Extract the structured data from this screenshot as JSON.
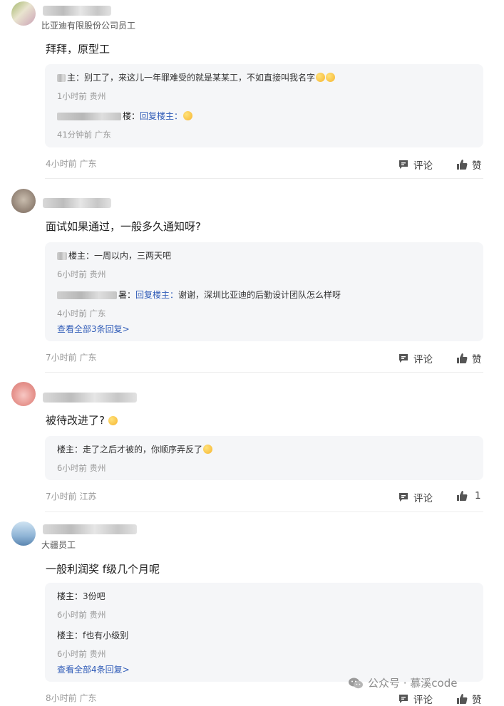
{
  "comments": [
    {
      "org": "比亚迪有限股份公司员工",
      "text": "拜拜，原型工",
      "replies": [
        {
          "author": "主：",
          "text": "别工了，来这儿一年罪难受的就是某某工，不如直接叫我名字",
          "meta": "1小时前 贵州"
        },
        {
          "author": "楼：",
          "reply_to": "回复楼主：",
          "text": "",
          "meta": "41分钟前 广东"
        }
      ],
      "more": "",
      "meta": "4小时前 广东",
      "comment_label": "评论",
      "like_label": "赞"
    },
    {
      "org": "",
      "text": "面试如果通过，一般多久通知呀?",
      "replies": [
        {
          "author": "楼主：",
          "text": "一周以内，三两天吧",
          "meta": "6小时前 贵州"
        },
        {
          "author": "暑：",
          "reply_to": "回复楼主：",
          "text": "谢谢，深圳比亚迪的后勤设计团队怎么样呀",
          "meta": "4小时前 广东"
        }
      ],
      "more": "查看全部3条回复>",
      "meta": "7小时前 广东",
      "comment_label": "评论",
      "like_label": "赞"
    },
    {
      "org": "",
      "text": "被待改进了?",
      "replies": [
        {
          "author": "楼主：",
          "text": "走了之后才被的，你顺序弄反了",
          "meta": "6小时前 贵州"
        }
      ],
      "more": "",
      "meta": "7小时前 江苏",
      "comment_label": "评论",
      "like_label": "1"
    },
    {
      "org": "大疆员工",
      "text": "一般利润奖 f级几个月呢",
      "replies": [
        {
          "author": "楼主：",
          "text": "3份吧",
          "meta": "6小时前 贵州"
        },
        {
          "author": "楼主：",
          "text": "f也有小级别",
          "meta": "6小时前 贵州"
        }
      ],
      "more": "查看全部4条回复>",
      "meta": "8小时前 广东",
      "comment_label": "评论",
      "like_label": "赞"
    }
  ],
  "watermark": "公众号 · 慕溪code",
  "colors": {
    "link": "#2f5bb7",
    "reply_bg": "#f5f6f8",
    "meta": "#999999"
  },
  "icons": {
    "comment": "comment-bubble-icon",
    "like": "thumbs-up-icon",
    "watermark": "wechat-icon"
  }
}
